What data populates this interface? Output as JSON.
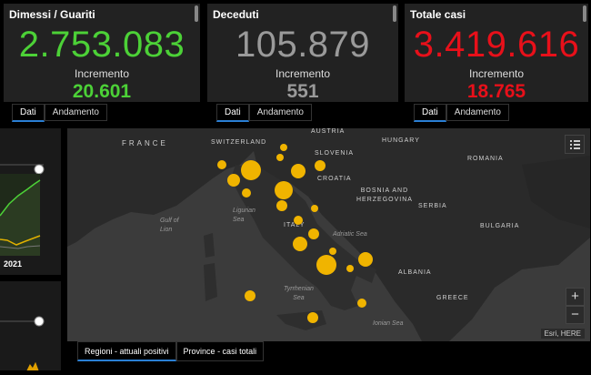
{
  "cards": [
    {
      "title": "Dimessi / Guariti",
      "value": "2.753.083",
      "increment_label": "Incremento",
      "increment": "20.601",
      "color": "#4cd137"
    },
    {
      "title": "Deceduti",
      "value": "105.879",
      "increment_label": "Incremento",
      "increment": "551",
      "color": "#9a9a9a"
    },
    {
      "title": "Totale casi",
      "value": "3.419.616",
      "increment_label": "Incremento",
      "increment": "18.765",
      "color": "#e8101a"
    }
  ],
  "card_tabs": {
    "dati": "Dati",
    "andamento": "Andamento"
  },
  "left_chart": {
    "year_label": "2021"
  },
  "map": {
    "country_labels": [
      "FRANCE",
      "SWITZERLAND",
      "AUSTRIA",
      "HUNGARY",
      "SLOVENIA",
      "ROMANIA",
      "CROATIA",
      "BOSNIA AND HERZEGOVINA",
      "SERBIA",
      "BULGARIA",
      "ITALY",
      "ALBANIA",
      "GREECE"
    ],
    "sea_labels": [
      "Gulf of Lion",
      "Ligurian Sea",
      "Adriatic Sea",
      "Tyrrhenian Sea",
      "Ionian Sea"
    ],
    "zoom_in": "+",
    "zoom_out": "−",
    "attribution": "Esri, HERE",
    "bubble_color": "#f0b400",
    "legend_icon": "list-icon"
  },
  "bottom_tabs": [
    "Regioni - attuali positivi",
    "Province - casi totali"
  ]
}
